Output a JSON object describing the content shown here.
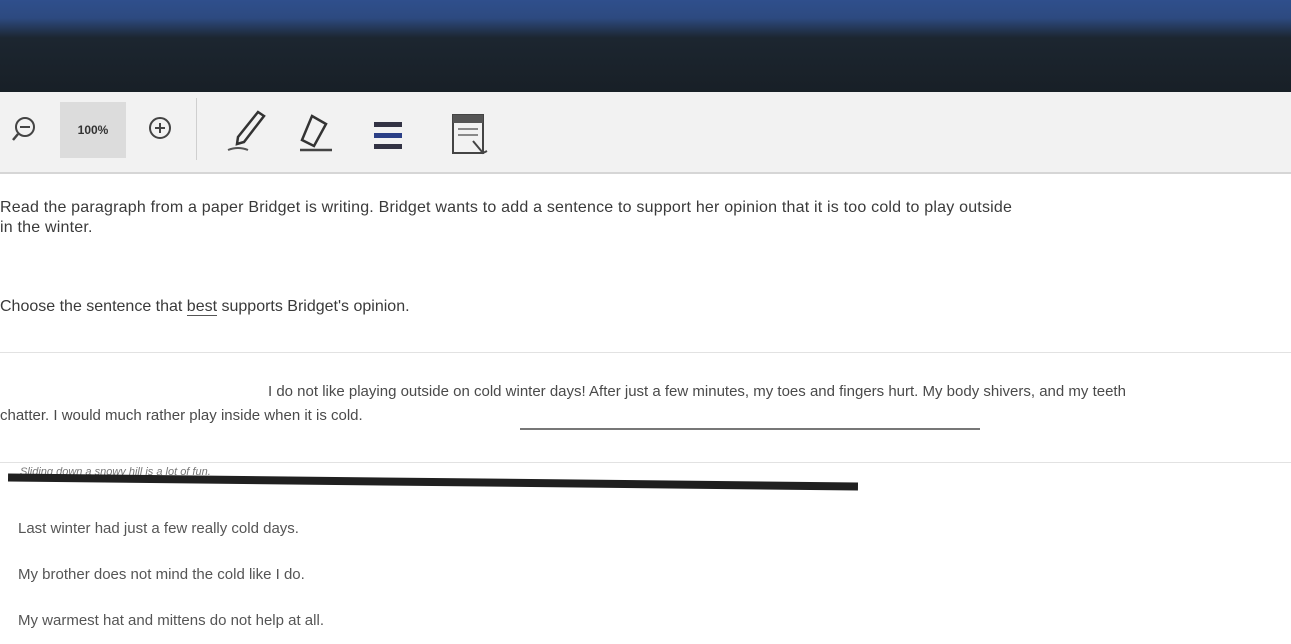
{
  "toolbar": {
    "zoom_out_icon": "zoom-out-icon",
    "zoom_level": "100%",
    "zoom_in_icon": "zoom-in-icon",
    "tools": [
      "pen-icon",
      "eraser-icon",
      "line-reader-icon",
      "notepad-icon"
    ]
  },
  "question": {
    "line1": "Read the paragraph from a paper Bridget is writing. Bridget wants to add a sentence to support her opinion that it is too cold to play outside",
    "line2": "in the winter."
  },
  "directions": {
    "before": "Choose the sentence that ",
    "emphasis": "best",
    "after": " supports Bridget's opinion."
  },
  "passage": {
    "line1": "I do not like playing outside on cold winter days! After just a few minutes, my toes and fingers hurt. My body shivers, and my teeth",
    "line2": "chatter. I would much rather play inside when it is cold."
  },
  "answers": {
    "selected": "Sliding down a snowy hill is a lot of fun.",
    "options": [
      "Last winter had just a few really cold days.",
      "My brother does not mind the cold like I do.",
      "My warmest hat and mittens do not help at all."
    ]
  }
}
